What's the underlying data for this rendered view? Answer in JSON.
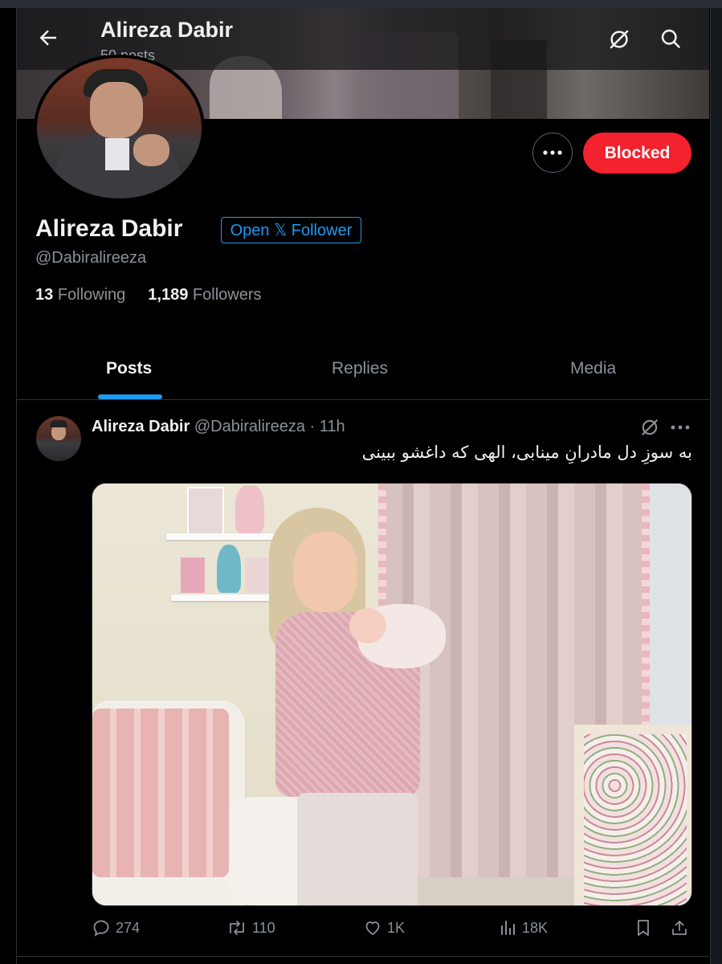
{
  "header": {
    "title": "Alireza Dabir",
    "subtitle": "50 posts"
  },
  "profile": {
    "name": "Alireza Dabir",
    "badge": "Open 𝕏 Follower",
    "handle": "@Dabiralireeza",
    "following_count": "13",
    "following_label": "Following",
    "followers_count": "1,189",
    "followers_label": "Followers",
    "blocked_label": "Blocked",
    "more_label": "···"
  },
  "tabs": [
    {
      "label": "Posts",
      "active": true
    },
    {
      "label": "Replies",
      "active": false
    },
    {
      "label": "Media",
      "active": false
    }
  ],
  "post": {
    "author": "Alireza Dabir",
    "handle": "@Dabiralireeza",
    "separator": "·",
    "time": "11h",
    "text": "به سوزِ دل مادرانِ مینابی، الهی که داغشو ببینی",
    "more_label": "···",
    "replies": "274",
    "reposts": "110",
    "likes": "1K",
    "views": "18K"
  },
  "colors": {
    "accent": "#1d9bf0",
    "blocked": "#f4212e",
    "muted": "#8b9198",
    "background": "#000000"
  },
  "icons": [
    "back-arrow-icon",
    "grok-icon",
    "search-icon",
    "more-icon",
    "reply-icon",
    "repost-icon",
    "like-icon",
    "views-icon",
    "bookmark-icon",
    "share-icon"
  ]
}
